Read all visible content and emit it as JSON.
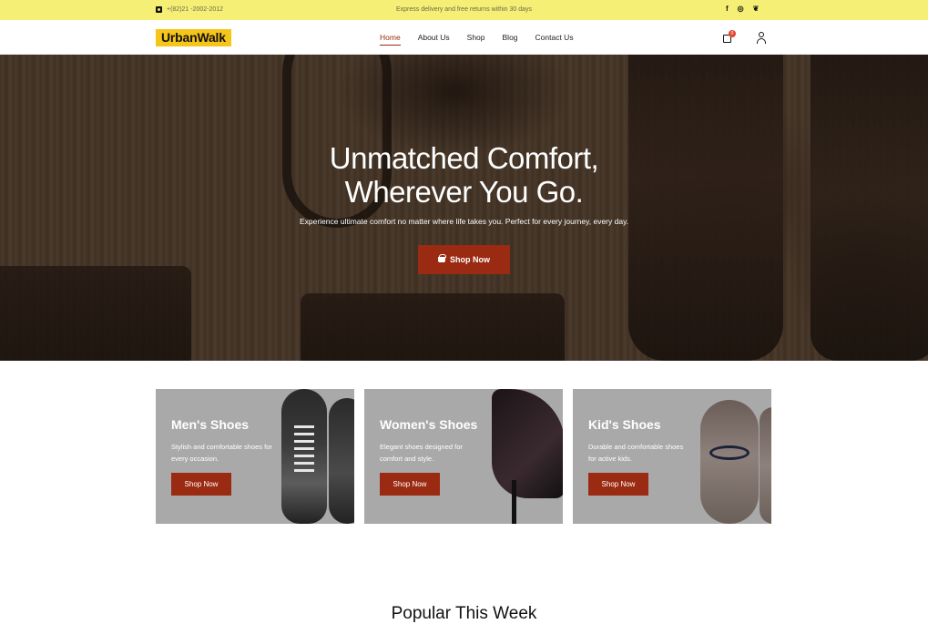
{
  "topbar": {
    "phone": "+(82)21 -2002-2012",
    "promo": "Express delivery and free returns within 30 days",
    "social": [
      "f",
      "◎",
      "❦"
    ]
  },
  "header": {
    "logo": "UrbanWalk",
    "nav": [
      "Home",
      "About Us",
      "Shop",
      "Blog",
      "Contact Us"
    ],
    "active_nav": "Home",
    "cart_count": "0"
  },
  "hero": {
    "title_line1": "Unmatched Comfort,",
    "title_line2": "Wherever You Go.",
    "subtitle": "Experience ultimate comfort no matter where life takes you. Perfect for every journey, every day.",
    "button": "Shop Now"
  },
  "categories": [
    {
      "title": "Men's Shoes",
      "desc": "Stylish and comfortable shoes for every occasion.",
      "button": "Shop Now"
    },
    {
      "title": "Women's Shoes",
      "desc": "Elegant shoes designed for comfort and style.",
      "button": "Shop Now"
    },
    {
      "title": "Kid's Shoes",
      "desc": "Durable and comfortable shoes for active kids.",
      "button": "Shop Now"
    }
  ],
  "section": {
    "title": "Popular This Week"
  },
  "colors": {
    "topbar": "#f6ef76",
    "accent": "#9b2a12",
    "logo_bg": "#f5c518",
    "card_bg": "#a9a9a9"
  }
}
